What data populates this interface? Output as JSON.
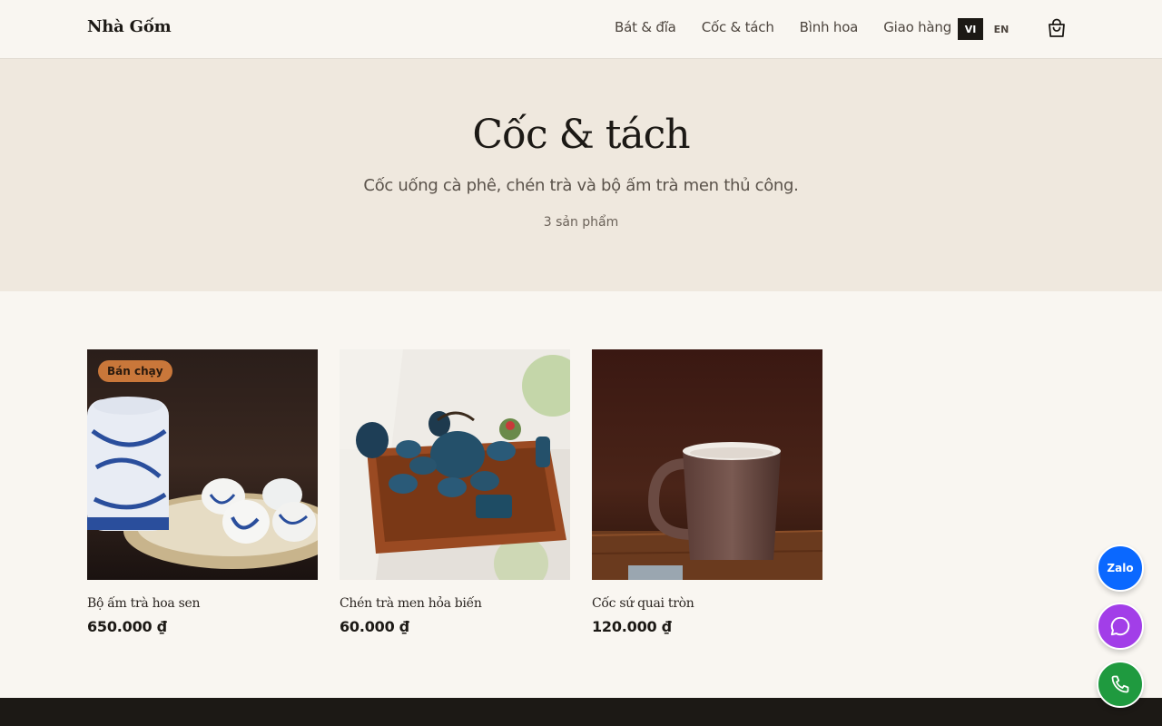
{
  "header": {
    "logo": "Nhà Gốm",
    "nav": [
      {
        "label": "Bát & đĩa"
      },
      {
        "label": "Cốc & tách"
      },
      {
        "label": "Bình hoa"
      },
      {
        "label": "Giao hàng"
      }
    ],
    "lang_active": "VI",
    "lang_other": "EN",
    "cart_icon": "shopping-bag-icon"
  },
  "hero": {
    "title": "Cốc & tách",
    "subtitle": "Cốc uống cà phê, chén trà và bộ ấm trà men thủ công.",
    "count": "3 sản phẩm"
  },
  "products": [
    {
      "name": "Bộ ấm trà hoa sen",
      "price": "650.000 ₫",
      "badge": "Bán chạy"
    },
    {
      "name": "Chén trà men hỏa biến",
      "price": "60.000 ₫"
    },
    {
      "name": "Cốc sứ quai tròn",
      "price": "120.000 ₫"
    }
  ],
  "floating": {
    "zalo_label": "Zalo",
    "chat_icon": "chat-bubble-icon",
    "phone_icon": "phone-icon"
  },
  "colors": {
    "background": "#f9f6f1",
    "hero_bg": "#efe8de",
    "badge": "#c9773a",
    "zalo": "#0a68ff",
    "chat": "#a23ee8",
    "phone": "#1f9a3f",
    "footer": "#1c1915"
  }
}
